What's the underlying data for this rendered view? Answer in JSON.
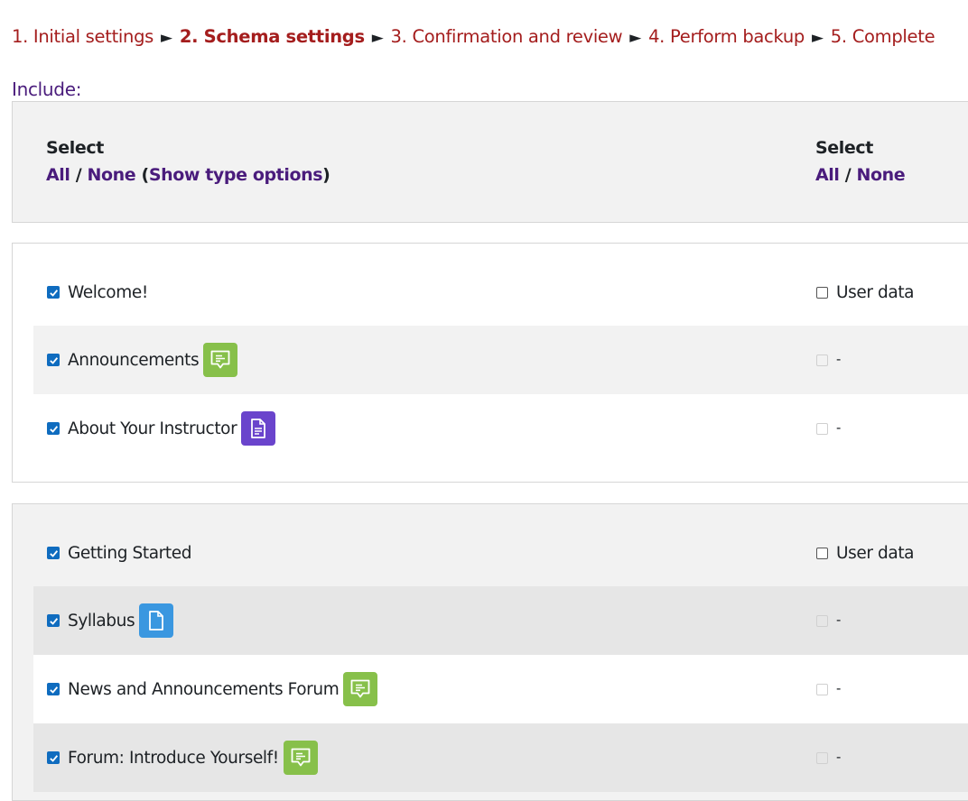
{
  "breadcrumb": {
    "steps": [
      "1. Initial settings",
      "2. Schema settings",
      "3. Confirmation and review",
      "4. Perform backup",
      "5. Complete"
    ],
    "separator": "►"
  },
  "include_label": "Include:",
  "select_header": {
    "left": {
      "title": "Select",
      "all": "All",
      "slash": "/",
      "none": "None",
      "open_paren": "(",
      "show_types": "Show type options",
      "close_paren": ")"
    },
    "right": {
      "title": "Select",
      "all": "All",
      "slash": "/",
      "none": "None"
    }
  },
  "sections": [
    {
      "title": "Welcome!",
      "user_data_label": "User data",
      "items": [
        {
          "label": "Announcements",
          "icon": "forum-icon",
          "user_data": "-"
        },
        {
          "label": "About Your Instructor",
          "icon": "page-icon",
          "user_data": "-"
        }
      ]
    },
    {
      "title": "Getting Started",
      "user_data_label": "User data",
      "items": [
        {
          "label": "Syllabus",
          "icon": "file-icon",
          "user_data": "-"
        },
        {
          "label": "News and Announcements Forum",
          "icon": "forum-icon",
          "user_data": "-"
        },
        {
          "label": "Forum: Introduce Yourself!",
          "icon": "forum-icon",
          "user_data": "-"
        }
      ]
    }
  ],
  "colors": {
    "breadcrumb": "#a41d1d",
    "link": "#4a1c7c",
    "checkbox": "#0f6cbf",
    "forum_icon_bg": "#87c04a",
    "page_icon_bg": "#6a44cc",
    "file_icon_bg": "#3a97e0"
  }
}
